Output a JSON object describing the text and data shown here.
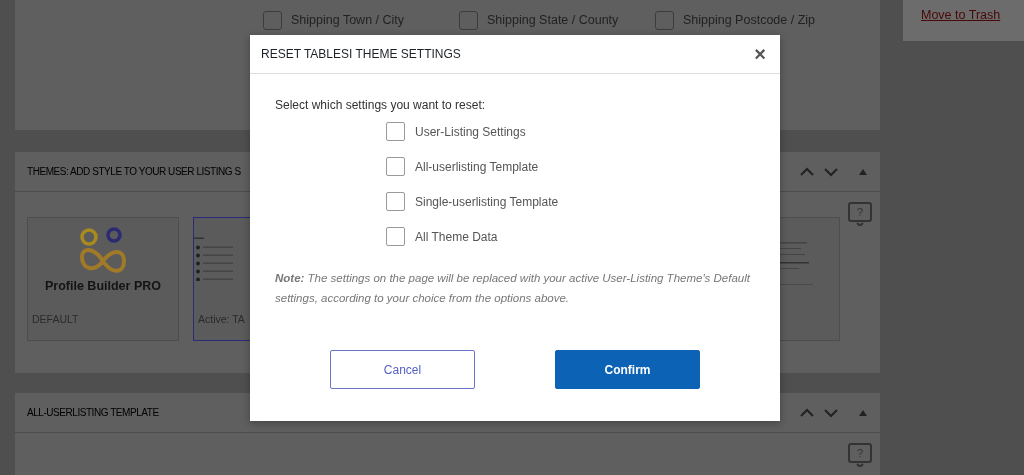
{
  "background": {
    "shipping_fields": [
      {
        "label": "Shipping Town / City",
        "checked": false
      },
      {
        "label": "Shipping State / County",
        "checked": false
      },
      {
        "label": "Shipping Postcode / Zip",
        "checked": false
      }
    ],
    "sidebar_link": "Move to Trash",
    "themes_panel": {
      "title": "THEMES: ADD STYLE TO YOUR USER LISTING S",
      "help": "?",
      "themes": [
        {
          "kind": "logo",
          "logo_text": "Profile Builder PRO",
          "label": "DEFAULT",
          "selected": false
        },
        {
          "kind": "list-preview",
          "label": "Active: TA",
          "selected": true
        },
        {
          "kind": "page-preview",
          "selected": false
        }
      ]
    },
    "template_panel": {
      "title": "ALL-USERLISTING TEMPLATE",
      "help": "?"
    }
  },
  "dialog": {
    "title": "RESET TABLESI THEME SETTINGS",
    "close": "×",
    "prompt": "Select which settings you want to reset:",
    "options": [
      {
        "label": "User-Listing Settings",
        "checked": false
      },
      {
        "label": "All-userlisting Template",
        "checked": false
      },
      {
        "label": "Single-userlisting Template",
        "checked": false
      },
      {
        "label": "All Theme Data",
        "checked": false
      }
    ],
    "note": "**Note:** The settings on the page will be replaced with your active User-Listing Theme's Default settings, according to your choice from the options above.",
    "buttons": [
      {
        "label": "Cancel",
        "kind": "secondary"
      },
      {
        "label": "Confirm",
        "kind": "primary"
      }
    ]
  }
}
